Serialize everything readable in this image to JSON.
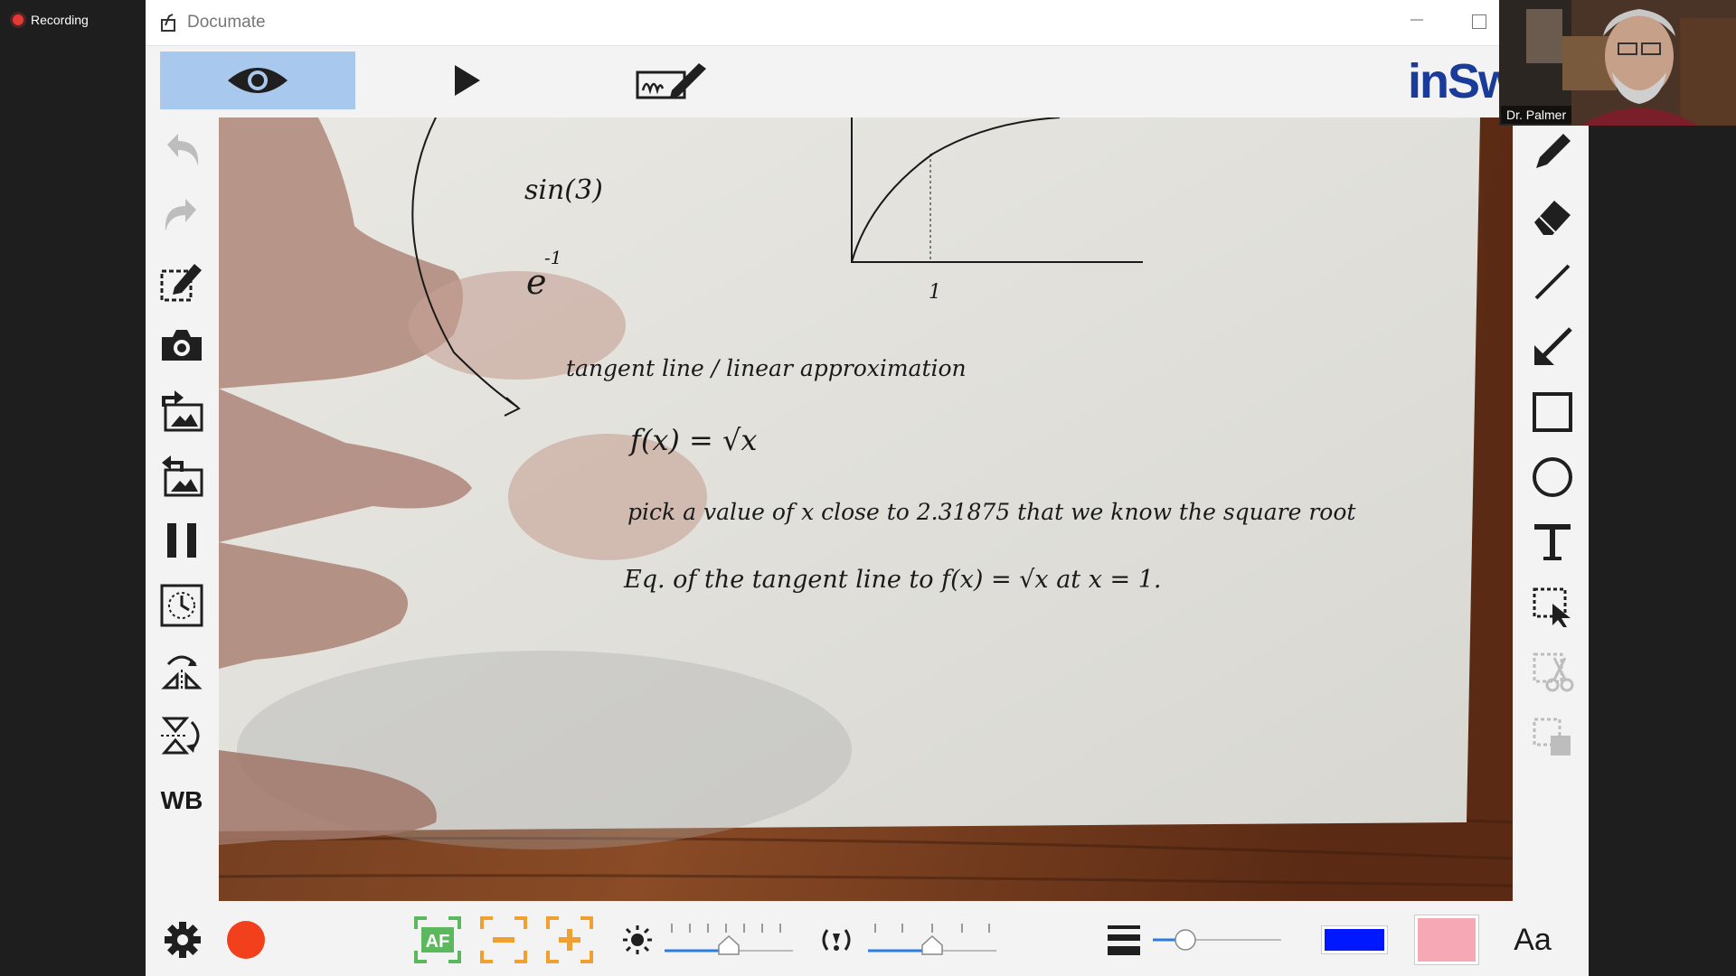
{
  "recording": {
    "label": "Recording"
  },
  "window": {
    "title": "Documate"
  },
  "toolbar": {
    "modes": [
      {
        "name": "live-view",
        "icon": "eye-icon",
        "active": true
      },
      {
        "name": "playback",
        "icon": "play-icon",
        "active": false
      },
      {
        "name": "annotate",
        "icon": "signature-icon",
        "active": false
      }
    ],
    "logo_text": "inSw"
  },
  "left_tools": [
    {
      "name": "undo-icon"
    },
    {
      "name": "redo-icon"
    },
    {
      "name": "edit-document-icon"
    },
    {
      "name": "camera-icon"
    },
    {
      "name": "import-image-icon"
    },
    {
      "name": "export-image-icon"
    },
    {
      "name": "pause-icon"
    },
    {
      "name": "timer-icon"
    },
    {
      "name": "flip-horizontal-icon"
    },
    {
      "name": "flip-vertical-icon"
    },
    {
      "name": "whiteboard",
      "label": "WB"
    }
  ],
  "right_tools": [
    {
      "name": "pen-icon"
    },
    {
      "name": "eraser-icon"
    },
    {
      "name": "line-icon"
    },
    {
      "name": "arrow-icon"
    },
    {
      "name": "rectangle-icon"
    },
    {
      "name": "circle-icon"
    },
    {
      "name": "text-icon"
    },
    {
      "name": "select-icon"
    },
    {
      "name": "cut-icon"
    },
    {
      "name": "copy-icon"
    }
  ],
  "document": {
    "lines": [
      "sin(3)",
      "e",
      "-1",
      "tangent line / linear approximation",
      "f(x) = √x",
      "pick a value of x close to 2.31875 that we know the square root",
      "Eq. of the tangent line to f(x) = √x at x = 1.",
      "1"
    ]
  },
  "bottombar": {
    "autofocus_label": "AF",
    "brightness_level": 0.5,
    "exposure_level": 0.5,
    "line_width_level": 0.25,
    "pen_color": "#0018ff",
    "highlight_color": "#f6a8b4",
    "font_label": "Aa",
    "record_color": "#f2401d"
  },
  "webcam": {
    "name": "Dr. Palmer"
  }
}
